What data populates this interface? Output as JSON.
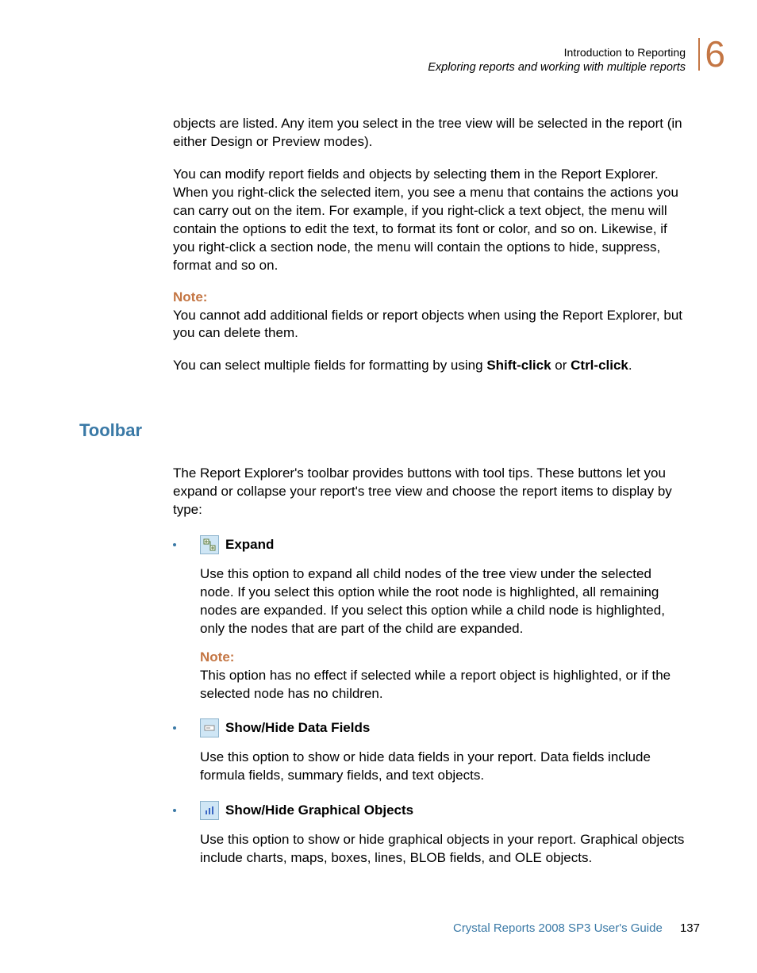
{
  "header": {
    "top": "Introduction to Reporting",
    "sub": "Exploring reports and working with multiple reports",
    "chapter": "6"
  },
  "intro1": "objects are listed. Any item you select in the tree view will be selected in the report (in either Design or Preview modes).",
  "intro2": "You can modify report fields and objects by selecting them in the Report Explorer. When you right-click the selected item, you see a menu that contains the actions you can carry out on the item. For example, if you right-click a text object, the menu will contain the options to edit the text, to format its font or color, and so on. Likewise, if you right-click a section node, the menu will contain the options to hide, suppress, format and so on.",
  "note1": {
    "label": "Note:",
    "body": "You cannot add additional fields or report objects when using the Report Explorer, but you can delete them."
  },
  "intro3_prefix": "You can select multiple fields for formatting by using ",
  "intro3_bold1": "Shift-click",
  "intro3_mid": " or ",
  "intro3_bold2": "Ctrl-click",
  "intro3_suffix": ".",
  "section_title": "Toolbar",
  "toolbar_intro": "The Report Explorer's toolbar provides buttons with tool tips. These buttons let you expand or collapse your report's tree view and choose the report items to display by type:",
  "items": [
    {
      "title": "Expand",
      "desc": "Use this option to expand all child nodes of the tree view under the selected node. If you select this option while the root node is highlighted, all remaining nodes are expanded. If you select this option while a child node is highlighted, only the nodes that are part of the child are expanded.",
      "note_label": "Note:",
      "note_body": "This option has no effect if selected while a report object is highlighted, or if the selected node has no children."
    },
    {
      "title": "Show/Hide Data Fields",
      "desc": "Use this option to show or hide data fields in your report. Data fields include formula fields, summary fields, and text objects."
    },
    {
      "title": "Show/Hide Graphical Objects",
      "desc": "Use this option to show or hide graphical objects in your report. Graphical objects include charts, maps, boxes, lines, BLOB fields, and OLE objects."
    }
  ],
  "footer": {
    "text": "Crystal Reports 2008 SP3 User's Guide",
    "page": "137"
  }
}
